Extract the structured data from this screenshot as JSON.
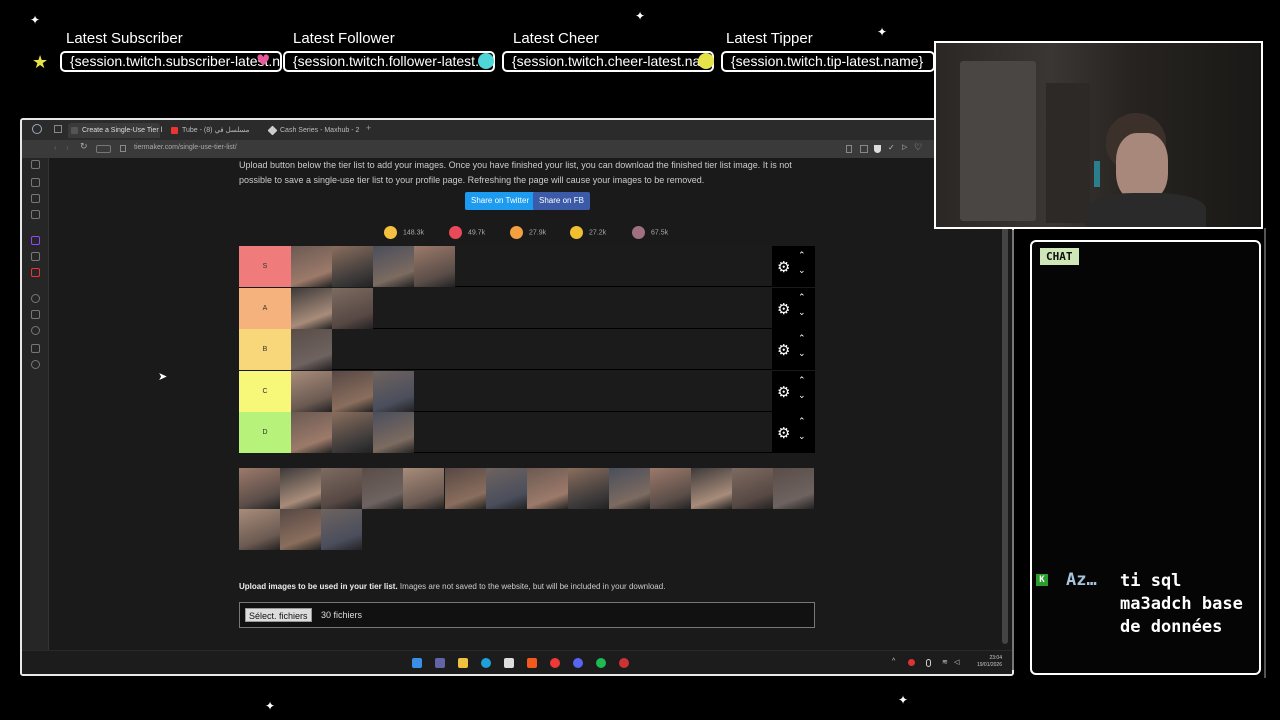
{
  "overlay": {
    "events": [
      {
        "title": "Latest Subscriber",
        "value": "{session.twitch.subscriber-latest.name}",
        "dot_color": "#e6e34a"
      },
      {
        "title": "Latest Follower",
        "value": "{session.twitch.follower-latest.name}",
        "dot_color": "#e85a9a"
      },
      {
        "title": "Latest Cheer",
        "value": "{session.twitch.cheer-latest.name}",
        "dot_color": "#4fd6d6"
      },
      {
        "title": "Latest Tipper",
        "value": "{session.twitch.tip-latest.name}",
        "dot_color": "#e6e34a"
      }
    ]
  },
  "browser": {
    "tabs": [
      {
        "label": "Create a Single-Use Tier l",
        "active": true,
        "icon_color": "#444"
      },
      {
        "label": "Tube - مسلسل في (8)",
        "active": false,
        "icon_color": "#e33"
      },
      {
        "label": "Cash Series - Maxhub - 2",
        "active": false,
        "icon_color": "#ccc"
      }
    ],
    "new_tab": "+",
    "url": "tiermaker.com/single-use-tier-list/"
  },
  "page": {
    "intro": "Upload button below the tier list to add your images. Once you have finished your list, you can download the finished tier list image. It is not possible to save a single-use tier list to your profile page. Refreshing the page will cause your images to be removed.",
    "share_twitter": "Share on Twitter",
    "share_fb": "Share on FB",
    "reactions": [
      {
        "count": "148.3k",
        "color": "#f4c040"
      },
      {
        "count": "49.7k",
        "color": "#e84a5a"
      },
      {
        "count": "27.9k",
        "color": "#f4a040"
      },
      {
        "count": "27.2k",
        "color": "#f0c030"
      },
      {
        "count": "67.5k",
        "color": "#a07080"
      }
    ],
    "tiers": [
      {
        "label": "S",
        "color": "#f07b7b",
        "count": 4
      },
      {
        "label": "A",
        "color": "#f5b27c",
        "count": 2
      },
      {
        "label": "B",
        "color": "#f7d77a",
        "count": 1
      },
      {
        "label": "C",
        "color": "#f7f77a",
        "count": 3
      },
      {
        "label": "D",
        "color": "#b7f27a",
        "count": 3
      }
    ],
    "upload_bold": "Upload images to be used in your tier list.",
    "upload_rest": " Images are not saved to the website, but will be included in your download.",
    "file_button": "Sélect. fichiers",
    "file_count": "30 fichiers"
  },
  "taskbar": {
    "time": "23:04",
    "date": "19/01/2026"
  },
  "chat": {
    "title": "CHAT",
    "messages": [
      {
        "user": "Az…",
        "badge": "K",
        "text": "ti sql ma3adch base de données"
      }
    ]
  }
}
